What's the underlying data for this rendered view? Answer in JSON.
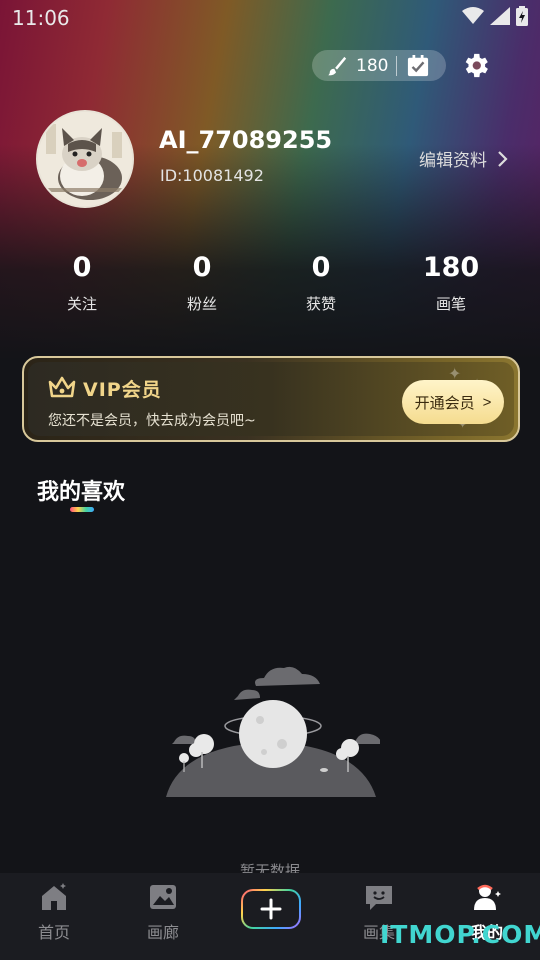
{
  "status_bar": {
    "time": "11:06"
  },
  "header": {
    "brush_count": "180"
  },
  "profile": {
    "username": "AI_77089255",
    "user_id": "ID:10081492",
    "edit_label": "编辑资料"
  },
  "stats": [
    {
      "value": "0",
      "label": "关注"
    },
    {
      "value": "0",
      "label": "粉丝"
    },
    {
      "value": "0",
      "label": "获赞"
    },
    {
      "value": "180",
      "label": "画笔"
    }
  ],
  "vip": {
    "title": "VIP会员",
    "subtitle": "您还不是会员，快去成为会员吧~",
    "button_label": "开通会员",
    "button_arrow": ">"
  },
  "favorites": {
    "title": "我的喜欢",
    "empty_text": "暂无数据"
  },
  "tabbar": {
    "items": [
      {
        "label": "首页",
        "icon": "home-icon"
      },
      {
        "label": "画廊",
        "icon": "gallery-icon"
      },
      {
        "label": "画集",
        "icon": "album-icon"
      },
      {
        "label": "我的",
        "icon": "profile-icon"
      }
    ],
    "active": "我的"
  },
  "watermark": "ITMOP.COM",
  "colors": {
    "background": "#131418",
    "vip_gold": "#f1d58a",
    "watermark": "#41d6d0"
  }
}
